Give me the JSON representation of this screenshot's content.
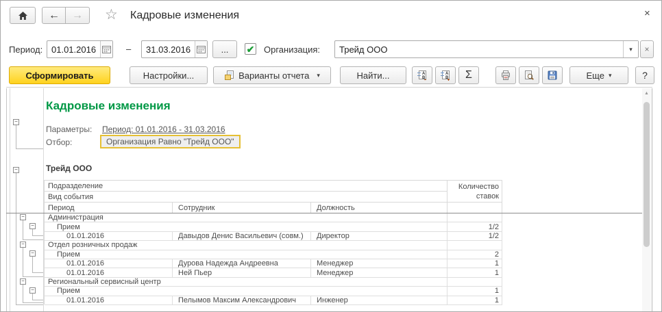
{
  "icons": {
    "back": "←",
    "forward": "→",
    "star": "☆",
    "close": "×",
    "check": "✔",
    "dropdown": "▾",
    "clear": "×",
    "minus": "−",
    "scroll_up": "▲"
  },
  "header": {
    "title": "Кадровые изменения"
  },
  "filters": {
    "period_label": "Период:",
    "date_from": "01.01.2016",
    "date_to": "31.03.2016",
    "range_dash": "–",
    "period_choice_label": "...",
    "organization_label": "Организация:",
    "organization_value": "Трейд ООО"
  },
  "toolbar": {
    "generate": "Сформировать",
    "settings": "Настройки...",
    "variants": "Варианты отчета",
    "find": "Найти...",
    "sum": "Σ",
    "more": "Еще",
    "help": "?"
  },
  "report": {
    "title": "Кадровые изменения",
    "params_label": "Параметры:",
    "params_value": "Период: 01.01.2016 - 31.03.2016",
    "filter_label": "Отбор:",
    "filter_value": "Организация Равно \"Трейд ООО\"",
    "group_title": "Трейд ООО",
    "table": {
      "headers": {
        "division": "Подразделение",
        "event_type": "Вид события",
        "period": "Период",
        "employee": "Сотрудник",
        "position": "Должность",
        "rate_count": "Количество ставок"
      },
      "rows": [
        {
          "type": "group2",
          "label": "Администрация",
          "count": ""
        },
        {
          "type": "group3",
          "label": "Прием",
          "count": "1/2"
        },
        {
          "type": "detail",
          "period": "01.01.2016",
          "employee": "Давыдов Денис Васильевич (совм.)",
          "position": "Директор",
          "count": "1/2"
        },
        {
          "type": "group2",
          "label": "Отдел розничных продаж",
          "count": ""
        },
        {
          "type": "group3",
          "label": "Прием",
          "count": "2"
        },
        {
          "type": "detail",
          "period": "01.01.2016",
          "employee": "Дурова Надежда Андреевна",
          "position": "Менеджер",
          "count": "1"
        },
        {
          "type": "detail",
          "period": "01.01.2016",
          "employee": "Ней Пьер",
          "position": "Менеджер",
          "count": "1"
        },
        {
          "type": "group2",
          "label": "Региональный сервисный центр",
          "count": ""
        },
        {
          "type": "group3",
          "label": "Прием",
          "count": "1"
        },
        {
          "type": "detail",
          "period": "01.01.2016",
          "employee": "Пелымов Максим Александрович",
          "position": "Инженер",
          "count": "1"
        }
      ]
    }
  }
}
